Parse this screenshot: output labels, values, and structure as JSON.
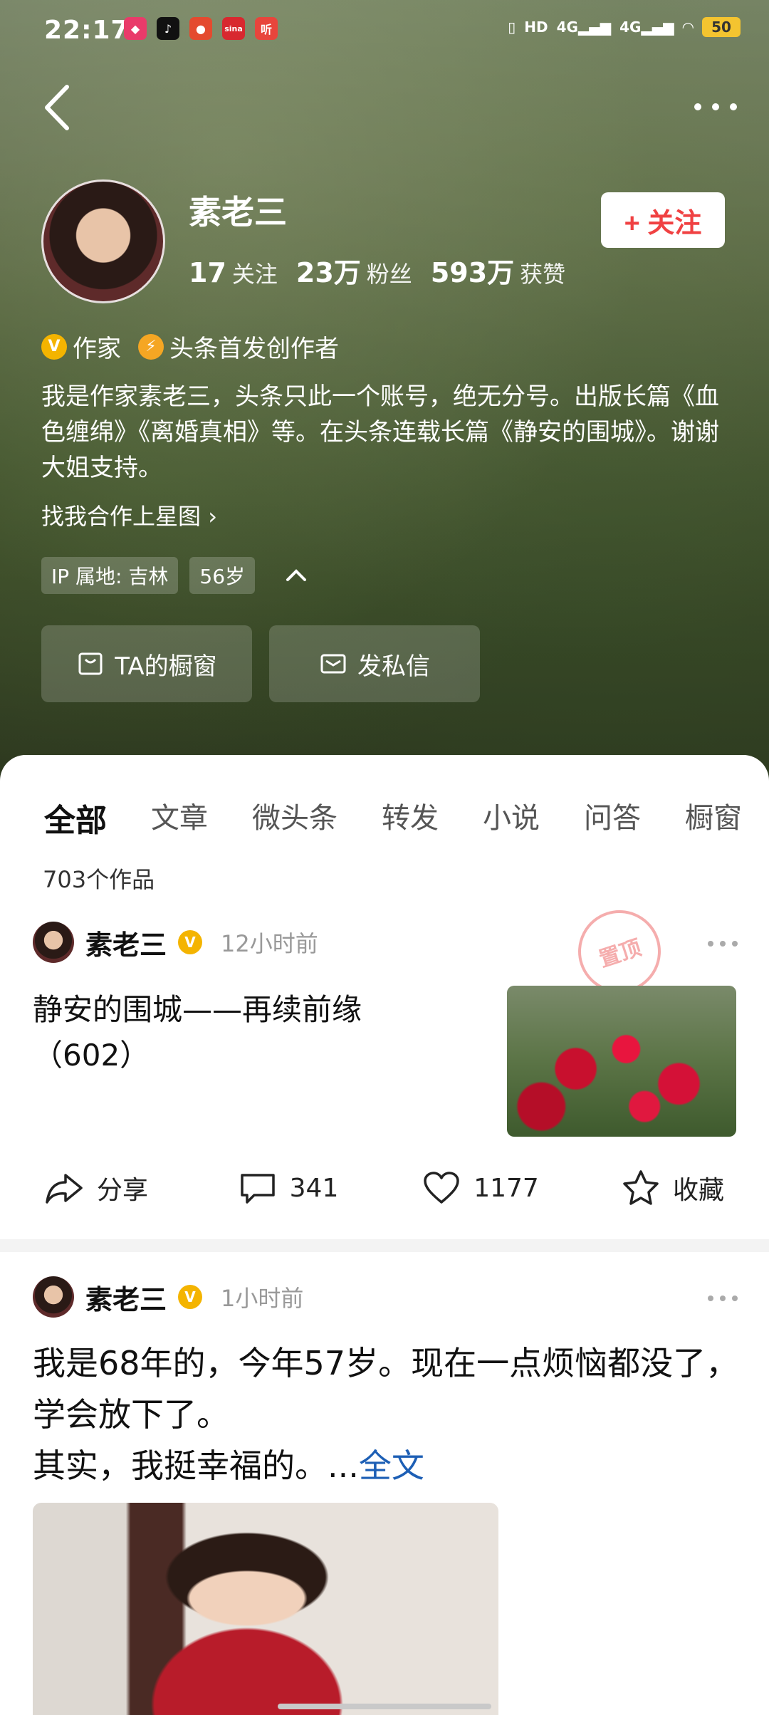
{
  "status_bar": {
    "time": "22:17",
    "battery": "50",
    "network_1": "4G",
    "network_2": "4G",
    "hd": "HD",
    "app_icons": [
      "app-icon-1",
      "tiktok-icon",
      "app-icon-3",
      "sina-icon",
      "ting-icon"
    ],
    "ting_label": "听",
    "sina_label": "sina"
  },
  "profile": {
    "name": "素老三",
    "follow_button": "+ 关注",
    "stats": [
      {
        "num": "17",
        "label": "关注"
      },
      {
        "num": "23万",
        "label": "粉丝"
      },
      {
        "num": "593万",
        "label": "获赞"
      }
    ],
    "badges": [
      {
        "icon": "v-badge-icon",
        "glyph": "V",
        "label": "作家"
      },
      {
        "icon": "lightning-badge-icon",
        "glyph": "⚡",
        "label": "头条首发创作者"
      }
    ],
    "bio": "我是作家素老三，头条只此一个账号，绝无分号。出版长篇《血色缠绵》《离婚真相》等。在头条连载长篇《静安的围城》。谢谢大姐支持。",
    "xingtu_link": "找我合作上星图",
    "tags": [
      "IP 属地: 吉林",
      "56岁"
    ],
    "actions": [
      {
        "icon": "shop-window-icon",
        "label": "TA的橱窗"
      },
      {
        "icon": "message-icon",
        "label": "发私信"
      }
    ]
  },
  "tabs": [
    "全部",
    "文章",
    "微头条",
    "转发",
    "小说",
    "问答",
    "橱窗"
  ],
  "active_tab": "全部",
  "works_count": "703个作品",
  "posts": [
    {
      "author": "素老三",
      "verified_glyph": "V",
      "time": "12小时前",
      "pinned_label": "置顶",
      "title": "静安的围城——再续前缘（602）",
      "image": "hollyhock-flowers-photo",
      "share_label": "分享",
      "comments": "341",
      "likes": "1177",
      "favorite_label": "收藏"
    },
    {
      "author": "素老三",
      "verified_glyph": "V",
      "time": "1小时前",
      "text_line1": "我是68年的，今年57岁。现在一点烦恼都没了，学会放下了。",
      "text_line2": "其实，我挺幸福的。...",
      "full_text_link": "全文",
      "image": "smiling-toddler-photo"
    }
  ],
  "colors": {
    "accent_red": "#f04142",
    "verified_yellow": "#f4b400",
    "link_blue": "#1d5fb5"
  }
}
